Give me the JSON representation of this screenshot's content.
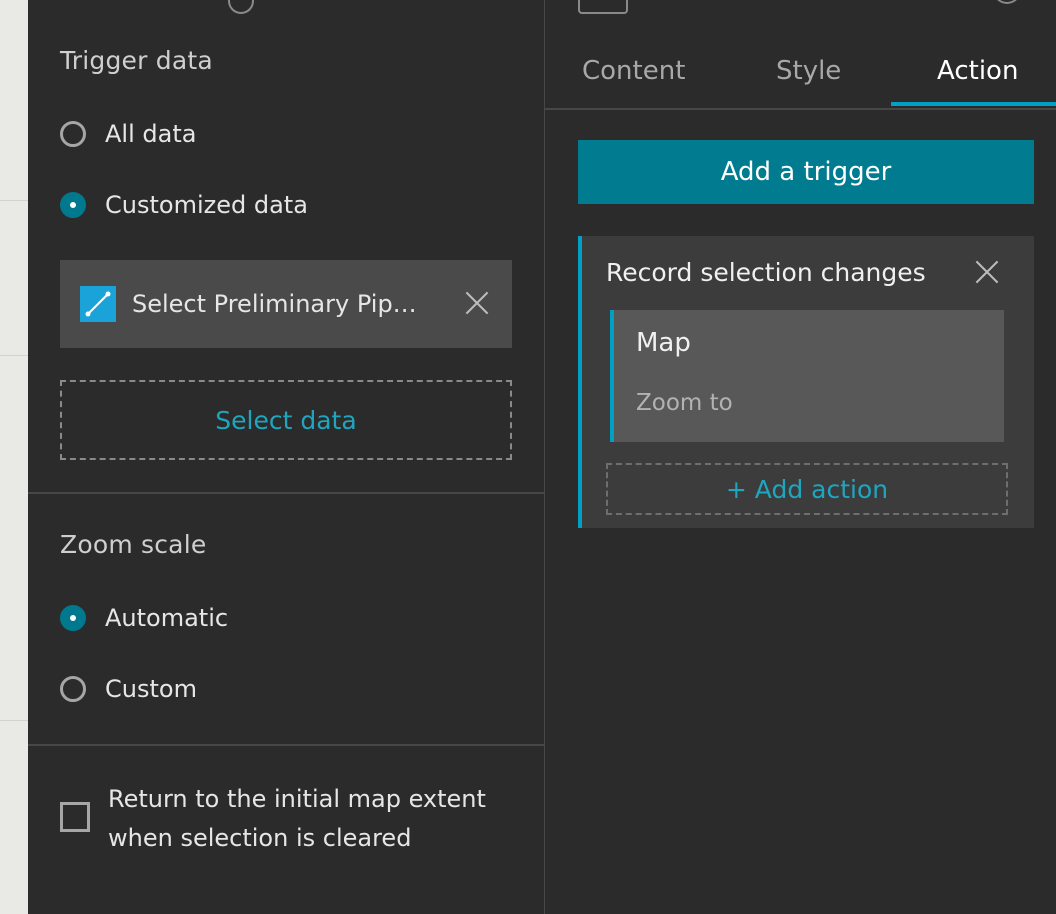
{
  "settings": {
    "trigger_data": {
      "title": "Trigger data",
      "options": [
        {
          "label": "All data",
          "selected": false
        },
        {
          "label": "Customized data",
          "selected": true
        }
      ],
      "selected_data_label": "Select Preliminary Pip…",
      "select_data_button": "Select data"
    },
    "zoom_scale": {
      "title": "Zoom scale",
      "options": [
        {
          "label": "Automatic",
          "selected": true
        },
        {
          "label": "Custom",
          "selected": false
        }
      ]
    },
    "return_extent": {
      "checked": false,
      "label_line1": "Return to the initial map extent",
      "label_line2": "when selection is cleared"
    }
  },
  "tabs": [
    {
      "label": "Content",
      "active": false
    },
    {
      "label": "Style",
      "active": false
    },
    {
      "label": "Action",
      "active": true
    }
  ],
  "action_panel": {
    "add_trigger_button": "Add a trigger",
    "trigger": {
      "title": "Record selection changes",
      "action": {
        "target": "Map",
        "name": "Zoom to"
      },
      "add_action_button": "+ Add action"
    }
  },
  "icons": {
    "layer": "polyline-layer-icon",
    "remove": "close-icon"
  },
  "colors": {
    "accent": "#00788d",
    "accent_text": "#1fa6bf",
    "tab_indicator": "#00a0c4",
    "panel_bg": "#2b2b2b"
  }
}
